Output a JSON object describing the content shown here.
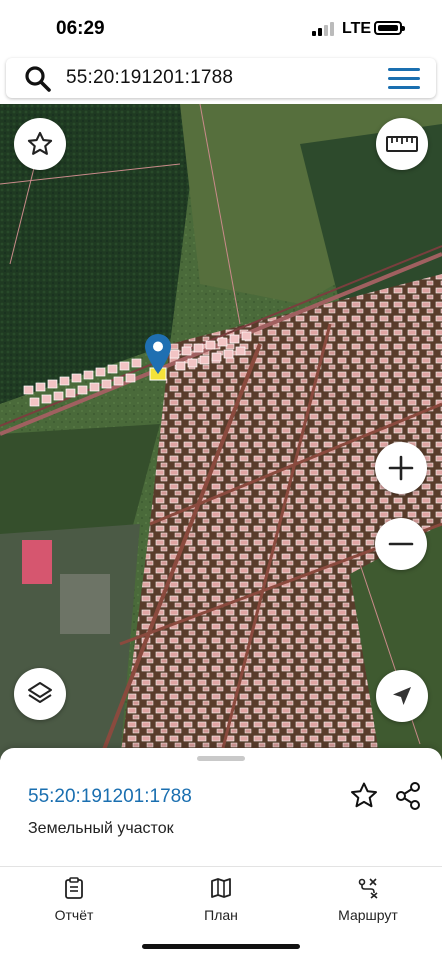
{
  "status_bar": {
    "time": "06:29",
    "network": "LTE"
  },
  "search": {
    "value": "55:20:191201:1788",
    "icon": "search-icon",
    "menu_icon": "hamburger-menu-icon"
  },
  "map": {
    "favorite_icon": "star-outline-icon",
    "measure_icon": "ruler-icon",
    "zoom_in_icon": "plus-icon",
    "zoom_out_icon": "minus-icon",
    "layers_icon": "layers-icon",
    "locate_icon": "navigation-arrow-icon",
    "marker_icon": "map-pin-icon",
    "colors": {
      "marker": "#1f6fb2",
      "parcel": "#e8a8a8",
      "imagery": "#3f5a30"
    }
  },
  "sheet": {
    "title": "55:20:191201:1788",
    "subtitle": "Земельный участок",
    "favorite_icon": "star-outline-icon",
    "share_icon": "share-icon"
  },
  "tabs": [
    {
      "label": "Отчёт",
      "icon": "report-clipboard-icon"
    },
    {
      "label": "План",
      "icon": "map-plan-icon"
    },
    {
      "label": "Маршрут",
      "icon": "route-icon"
    }
  ]
}
